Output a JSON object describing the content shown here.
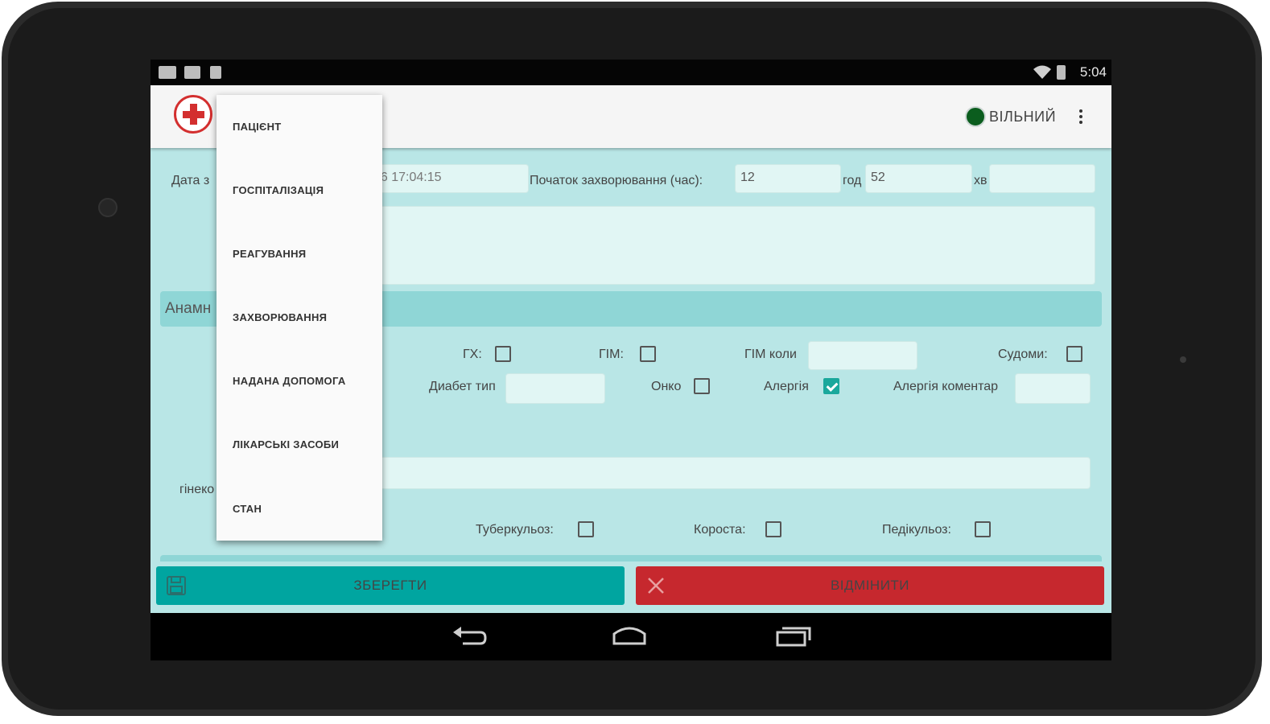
{
  "status_bar": {
    "time": "5:04",
    "icons": [
      "notification-icon",
      "download-icon",
      "sd-card-icon",
      "wifi-icon",
      "battery-icon"
    ]
  },
  "app_bar": {
    "logo_icon": "red-cross-icon",
    "status_text": "ВІЛЬНИЙ",
    "status_color": "#0b5d1e",
    "overflow_icon": "more-vert-icon"
  },
  "drawer_menu": {
    "items": [
      {
        "label": "ПАЦІЄНТ"
      },
      {
        "label": "ГОСПІТАЛІЗАЦІЯ"
      },
      {
        "label": "РЕАГУВАННЯ"
      },
      {
        "label": "ЗАХВОРЮВАННЯ"
      },
      {
        "label": "НАДАНА ДОПОМОГА"
      },
      {
        "label": "ЛІКАРСЬКІ ЗАСОБИ"
      },
      {
        "label": "СТАН"
      }
    ]
  },
  "form": {
    "date_label_visible": "Дата з",
    "date_value_visible": "16 17:04:15",
    "onset_label": "Початок захворювання (час):",
    "onset_value": "12",
    "hours_label": "год",
    "hours_value": "52",
    "minutes_label": "хв",
    "minutes_value": "",
    "section_title_visible": "Анамн",
    "gx_label": "ГХ:",
    "gim_label": "ГІМ:",
    "gim_when_label": "ГІМ коли",
    "gim_when_value": "",
    "seizures_label": "Судоми:",
    "diabetes_label": "Диабет тип",
    "diabetes_value": "",
    "onko_label": "Онко",
    "allergy_label": "Алергія",
    "allergy_comment_label": "Алергія коментар",
    "allergy_comment_value": "",
    "gyneco_label_visible": "гінеко",
    "tuberculosis_label": "Туберкульоз:",
    "scabies_label": "Короста:",
    "pediculosis_label": "Педікульоз:",
    "checkboxes": {
      "gx": false,
      "gim": false,
      "seizures": false,
      "onko": false,
      "allergy": true,
      "tuberculosis": false,
      "scabies": false,
      "pediculosis": false
    }
  },
  "buttons": {
    "save_label": "ЗБЕРЕГТИ",
    "cancel_label": "ВІДМІНИТИ",
    "save_color": "#00a5a0",
    "cancel_color": "#c6282e"
  },
  "nav_bar": {
    "icons": [
      "back-icon",
      "home-icon",
      "recents-icon"
    ]
  }
}
